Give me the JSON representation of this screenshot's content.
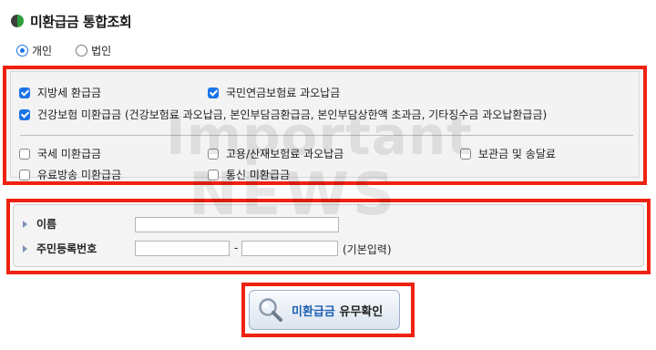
{
  "header": {
    "title": "미환급금 통합조회",
    "icon": "green-leaf-icon"
  },
  "person_type": {
    "options": [
      {
        "label": "개인",
        "selected": true
      },
      {
        "label": "법인",
        "selected": false
      }
    ]
  },
  "categories": {
    "primary": [
      {
        "label": "지방세 환급금",
        "checked": true
      },
      {
        "label": "국민연금보험료 과오납금",
        "checked": true
      },
      {
        "label": "건강보험 미환급금 (건강보험료 과오납금, 본인부담금환급금, 본인부담상한액 초과금, 기타징수금 과오납환급금)",
        "checked": true
      }
    ],
    "secondary": [
      {
        "label": "국세 미환급금",
        "checked": false
      },
      {
        "label": "고용/산재보험료 과오납금",
        "checked": false
      },
      {
        "label": "보관금 및 송달료",
        "checked": false
      },
      {
        "label": "유료방송 미환급금",
        "checked": false
      },
      {
        "label": "통신 미환급금",
        "checked": false
      }
    ]
  },
  "form": {
    "name_label": "이름",
    "name_value": "",
    "rrn_label": "주민등록번호",
    "rrn_front": "",
    "rrn_back": "",
    "separator": "-",
    "hint": "(기본입력)"
  },
  "submit": {
    "label_blue": "미환급금",
    "label_dark": "유무확인",
    "icon": "magnifier-icon"
  },
  "watermark": {
    "line1": "Important",
    "line2": "NEWS"
  },
  "colors": {
    "highlight": "#ee2211",
    "accent": "#1a73e8",
    "brand_green": "#2e7d32"
  }
}
